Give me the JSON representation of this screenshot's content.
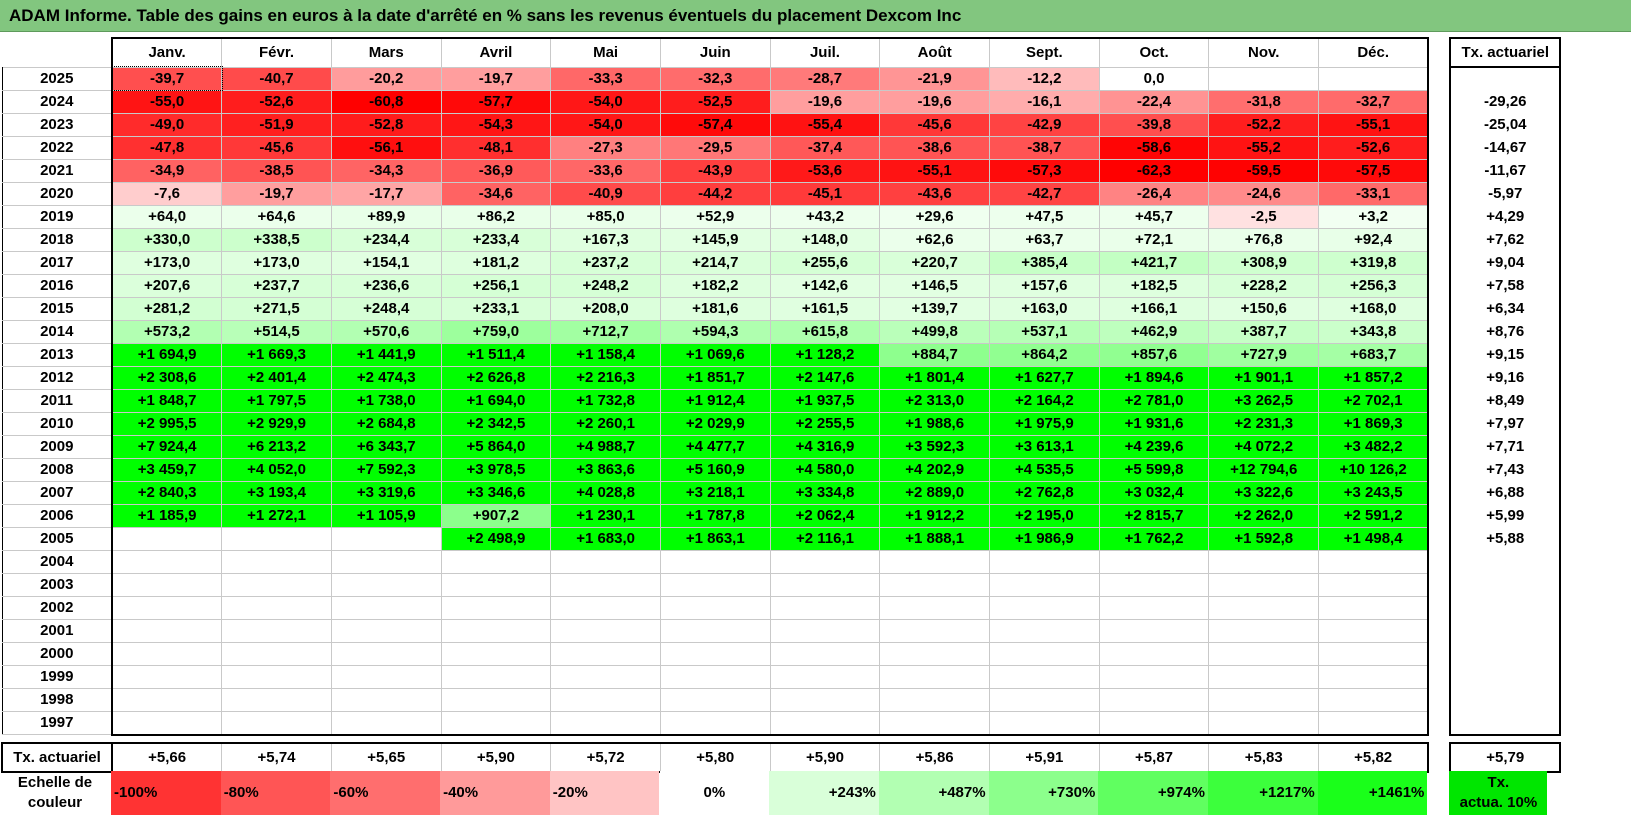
{
  "title": "ADAM Informe. Table des gains en euros à la date d'arrêté en % sans les revenus éventuels du placement Dexcom Inc",
  "months": [
    "Janv.",
    "Févr.",
    "Mars",
    "Avril",
    "Mai",
    "Juin",
    "Juil.",
    "Août",
    "Sept.",
    "Oct.",
    "Nov.",
    "Déc."
  ],
  "annual_header": "Tx. actuariel",
  "rows": [
    {
      "year": "2025",
      "values": [
        "-39,7",
        "-40,7",
        "-20,2",
        "-19,7",
        "-33,3",
        "-32,3",
        "-28,7",
        "-21,9",
        "-12,2",
        "0,0",
        "",
        ""
      ],
      "annual": ""
    },
    {
      "year": "2024",
      "values": [
        "-55,0",
        "-52,6",
        "-60,8",
        "-57,7",
        "-54,0",
        "-52,5",
        "-19,6",
        "-19,6",
        "-16,1",
        "-22,4",
        "-31,8",
        "-32,7"
      ],
      "annual": "-29,26"
    },
    {
      "year": "2023",
      "values": [
        "-49,0",
        "-51,9",
        "-52,8",
        "-54,3",
        "-54,0",
        "-57,4",
        "-55,4",
        "-45,6",
        "-42,9",
        "-39,8",
        "-52,2",
        "-55,1"
      ],
      "annual": "-25,04"
    },
    {
      "year": "2022",
      "values": [
        "-47,8",
        "-45,6",
        "-56,1",
        "-48,1",
        "-27,3",
        "-29,5",
        "-37,4",
        "-38,6",
        "-38,7",
        "-58,6",
        "-55,2",
        "-52,6"
      ],
      "annual": "-14,67"
    },
    {
      "year": "2021",
      "values": [
        "-34,9",
        "-38,5",
        "-34,3",
        "-36,9",
        "-33,6",
        "-43,9",
        "-53,6",
        "-55,1",
        "-57,3",
        "-62,3",
        "-59,5",
        "-57,5"
      ],
      "annual": "-11,67"
    },
    {
      "year": "2020",
      "values": [
        "-7,6",
        "-19,7",
        "-17,7",
        "-34,6",
        "-40,9",
        "-44,2",
        "-45,1",
        "-43,6",
        "-42,7",
        "-26,4",
        "-24,6",
        "-33,1"
      ],
      "annual": "-5,97"
    },
    {
      "year": "2019",
      "values": [
        "+64,0",
        "+64,6",
        "+89,9",
        "+86,2",
        "+85,0",
        "+52,9",
        "+43,2",
        "+29,6",
        "+47,5",
        "+45,7",
        "-2,5",
        "+3,2"
      ],
      "annual": "+4,29"
    },
    {
      "year": "2018",
      "values": [
        "+330,0",
        "+338,5",
        "+234,4",
        "+233,4",
        "+167,3",
        "+145,9",
        "+148,0",
        "+62,6",
        "+63,7",
        "+72,1",
        "+76,8",
        "+92,4"
      ],
      "annual": "+7,62"
    },
    {
      "year": "2017",
      "values": [
        "+173,0",
        "+173,0",
        "+154,1",
        "+181,2",
        "+237,2",
        "+214,7",
        "+255,6",
        "+220,7",
        "+385,4",
        "+421,7",
        "+308,9",
        "+319,8"
      ],
      "annual": "+9,04"
    },
    {
      "year": "2016",
      "values": [
        "+207,6",
        "+237,7",
        "+236,6",
        "+256,1",
        "+248,2",
        "+182,2",
        "+142,6",
        "+146,5",
        "+157,6",
        "+182,5",
        "+228,2",
        "+256,3"
      ],
      "annual": "+7,58"
    },
    {
      "year": "2015",
      "values": [
        "+281,2",
        "+271,5",
        "+248,4",
        "+233,1",
        "+208,0",
        "+181,6",
        "+161,5",
        "+139,7",
        "+163,0",
        "+166,1",
        "+150,6",
        "+168,0"
      ],
      "annual": "+6,34"
    },
    {
      "year": "2014",
      "values": [
        "+573,2",
        "+514,5",
        "+570,6",
        "+759,0",
        "+712,7",
        "+594,3",
        "+615,8",
        "+499,8",
        "+537,1",
        "+462,9",
        "+387,7",
        "+343,8"
      ],
      "annual": "+8,76"
    },
    {
      "year": "2013",
      "values": [
        "+1 694,9",
        "+1 669,3",
        "+1 441,9",
        "+1 511,4",
        "+1 158,4",
        "+1 069,6",
        "+1 128,2",
        "+884,7",
        "+864,2",
        "+857,6",
        "+727,9",
        "+683,7"
      ],
      "annual": "+9,15"
    },
    {
      "year": "2012",
      "values": [
        "+2 308,6",
        "+2 401,4",
        "+2 474,3",
        "+2 626,8",
        "+2 216,3",
        "+1 851,7",
        "+2 147,6",
        "+1 801,4",
        "+1 627,7",
        "+1 894,6",
        "+1 901,1",
        "+1 857,2"
      ],
      "annual": "+9,16"
    },
    {
      "year": "2011",
      "values": [
        "+1 848,7",
        "+1 797,5",
        "+1 738,0",
        "+1 694,0",
        "+1 732,8",
        "+1 912,4",
        "+1 937,5",
        "+2 313,0",
        "+2 164,2",
        "+2 781,0",
        "+3 262,5",
        "+2 702,1"
      ],
      "annual": "+8,49"
    },
    {
      "year": "2010",
      "values": [
        "+2 995,5",
        "+2 929,9",
        "+2 684,8",
        "+2 342,5",
        "+2 260,1",
        "+2 029,9",
        "+2 255,5",
        "+1 988,6",
        "+1 975,9",
        "+1 931,6",
        "+2 231,3",
        "+1 869,3"
      ],
      "annual": "+7,97"
    },
    {
      "year": "2009",
      "values": [
        "+7 924,4",
        "+6 213,2",
        "+6 343,7",
        "+5 864,0",
        "+4 988,7",
        "+4 477,7",
        "+4 316,9",
        "+3 592,3",
        "+3 613,1",
        "+4 239,6",
        "+4 072,2",
        "+3 482,2"
      ],
      "annual": "+7,71"
    },
    {
      "year": "2008",
      "values": [
        "+3 459,7",
        "+4 052,0",
        "+7 592,3",
        "+3 978,5",
        "+3 863,6",
        "+5 160,9",
        "+4 580,0",
        "+4 202,9",
        "+4 535,5",
        "+5 599,8",
        "+12 794,6",
        "+10 126,2"
      ],
      "annual": "+7,43"
    },
    {
      "year": "2007",
      "values": [
        "+2 840,3",
        "+3 193,4",
        "+3 319,6",
        "+3 346,6",
        "+4 028,8",
        "+3 218,1",
        "+3 334,8",
        "+2 889,0",
        "+2 762,8",
        "+3 032,4",
        "+3 322,6",
        "+3 243,5"
      ],
      "annual": "+6,88"
    },
    {
      "year": "2006",
      "values": [
        "+1 185,9",
        "+1 272,1",
        "+1 105,9",
        "+907,2",
        "+1 230,1",
        "+1 787,8",
        "+2 062,4",
        "+1 912,2",
        "+2 195,0",
        "+2 815,7",
        "+2 262,0",
        "+2 591,2"
      ],
      "annual": "+5,99"
    },
    {
      "year": "2005",
      "values": [
        "",
        "",
        "",
        "+2 498,9",
        "+1 683,0",
        "+1 863,1",
        "+2 116,1",
        "+1 888,1",
        "+1 986,9",
        "+1 762,2",
        "+1 592,8",
        "+1 498,4"
      ],
      "annual": "+5,88"
    },
    {
      "year": "2004",
      "values": [
        "",
        "",
        "",
        "",
        "",
        "",
        "",
        "",
        "",
        "",
        "",
        ""
      ],
      "annual": ""
    },
    {
      "year": "2003",
      "values": [
        "",
        "",
        "",
        "",
        "",
        "",
        "",
        "",
        "",
        "",
        "",
        ""
      ],
      "annual": ""
    },
    {
      "year": "2002",
      "values": [
        "",
        "",
        "",
        "",
        "",
        "",
        "",
        "",
        "",
        "",
        "",
        ""
      ],
      "annual": ""
    },
    {
      "year": "2001",
      "values": [
        "",
        "",
        "",
        "",
        "",
        "",
        "",
        "",
        "",
        "",
        "",
        ""
      ],
      "annual": ""
    },
    {
      "year": "2000",
      "values": [
        "",
        "",
        "",
        "",
        "",
        "",
        "",
        "",
        "",
        "",
        "",
        ""
      ],
      "annual": ""
    },
    {
      "year": "1999",
      "values": [
        "",
        "",
        "",
        "",
        "",
        "",
        "",
        "",
        "",
        "",
        "",
        ""
      ],
      "annual": ""
    },
    {
      "year": "1998",
      "values": [
        "",
        "",
        "",
        "",
        "",
        "",
        "",
        "",
        "",
        "",
        "",
        ""
      ],
      "annual": ""
    },
    {
      "year": "1997",
      "values": [
        "",
        "",
        "",
        "",
        "",
        "",
        "",
        "",
        "",
        "",
        "",
        ""
      ],
      "annual": ""
    }
  ],
  "footer": {
    "label": "Tx. actuariel",
    "values": [
      "+5,66",
      "+5,74",
      "+5,65",
      "+5,90",
      "+5,72",
      "+5,80",
      "+5,90",
      "+5,86",
      "+5,91",
      "+5,87",
      "+5,83",
      "+5,82"
    ],
    "annual": "+5,79"
  },
  "legend": {
    "label_line1": "Echelle de",
    "label_line2": "couleur",
    "items": [
      {
        "text": "-100%",
        "color": "#ff3333",
        "align": "left"
      },
      {
        "text": "-80%",
        "color": "#ff5555",
        "align": "left"
      },
      {
        "text": "-60%",
        "color": "#ff6e6e",
        "align": "left"
      },
      {
        "text": "-40%",
        "color": "#ff9a9a",
        "align": "left"
      },
      {
        "text": "-20%",
        "color": "#ffc4c4",
        "align": "left"
      },
      {
        "text": "0%",
        "color": "#ffffff",
        "align": "center"
      },
      {
        "text": "+243%",
        "color": "#d9ffd9",
        "align": "right"
      },
      {
        "text": "+487%",
        "color": "#b2ffb2",
        "align": "right"
      },
      {
        "text": "+730%",
        "color": "#8cff8c",
        "align": "right"
      },
      {
        "text": "+974%",
        "color": "#60ff60",
        "align": "right"
      },
      {
        "text": "+1217%",
        "color": "#3cff3c",
        "align": "right"
      },
      {
        "text": "+1461%",
        "color": "#1aff1a",
        "align": "right"
      }
    ],
    "actuarial_line1": "Tx.",
    "actuarial_line2": "actua. 10%",
    "actuarial_color": "#00e600"
  },
  "colors": {
    "title_bar": "#82c67f",
    "negative_base": "#ff0000",
    "positive_base": "#00ff00"
  }
}
